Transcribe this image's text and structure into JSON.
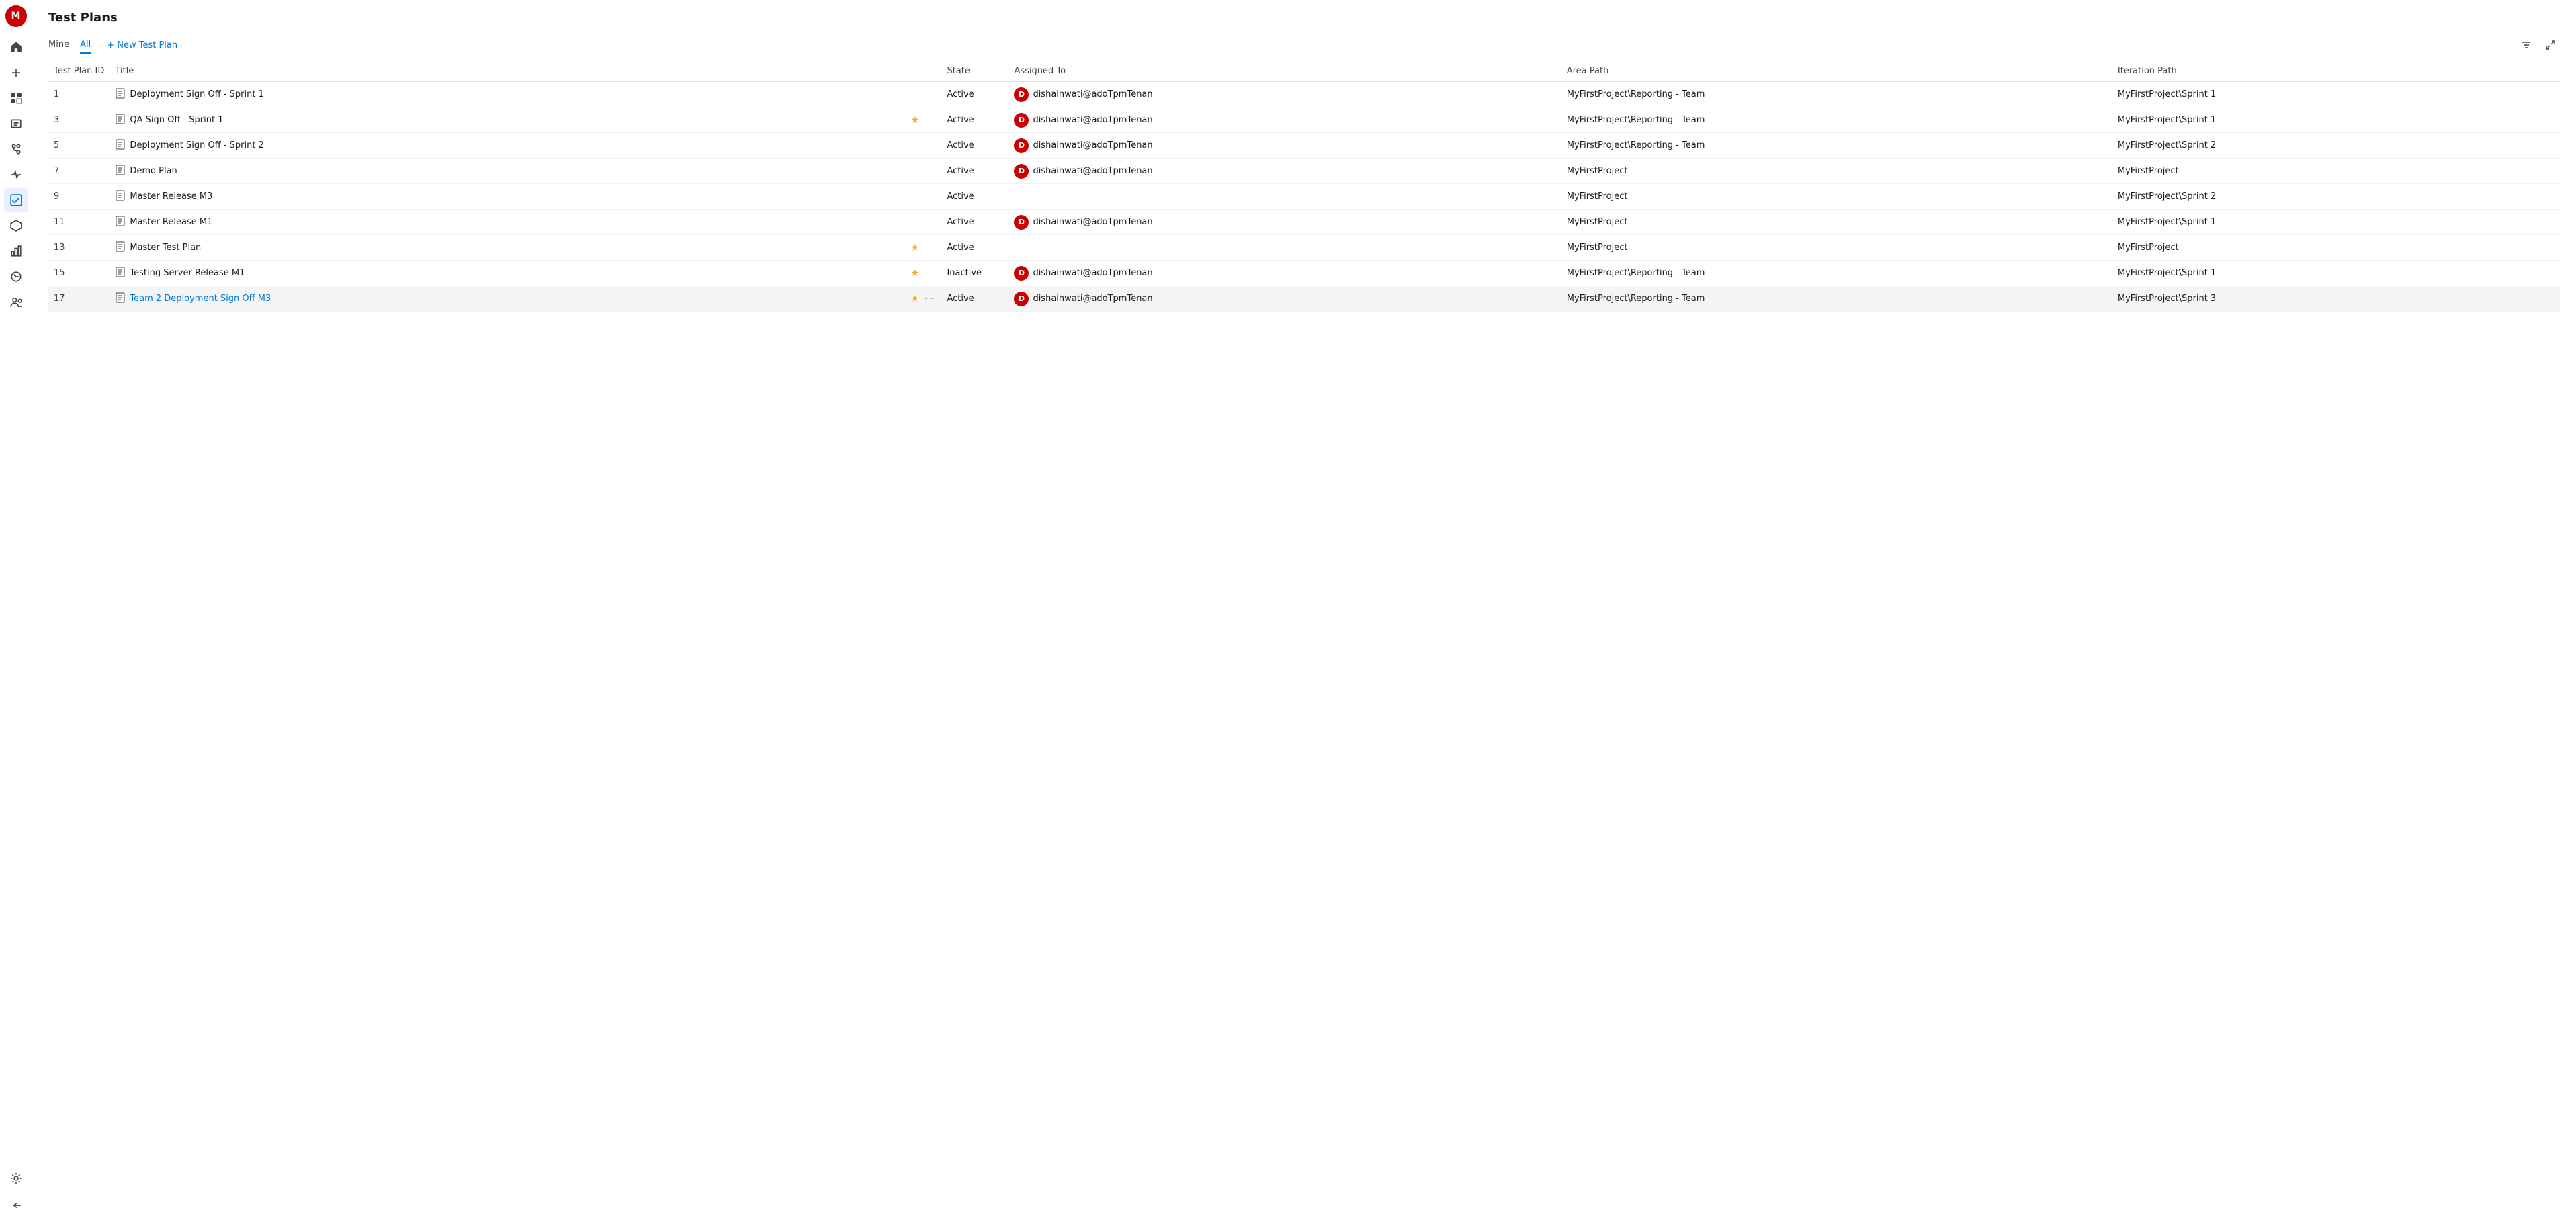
{
  "page": {
    "title": "Test Plans"
  },
  "nav": {
    "avatar_letter": "M",
    "icons": [
      {
        "name": "home-icon",
        "glyph": "⌂"
      },
      {
        "name": "plus-icon",
        "glyph": "+"
      },
      {
        "name": "board-icon",
        "glyph": "▦"
      },
      {
        "name": "work-icon",
        "glyph": "✎"
      },
      {
        "name": "repos-icon",
        "glyph": "⎇"
      },
      {
        "name": "pipelines-icon",
        "glyph": "▶"
      },
      {
        "name": "test-plans-icon",
        "glyph": "✅"
      },
      {
        "name": "artifacts-icon",
        "glyph": "📦"
      },
      {
        "name": "reports-icon",
        "glyph": "📊"
      },
      {
        "name": "analytics-icon",
        "glyph": "📈"
      },
      {
        "name": "stakeholder-icon",
        "glyph": "👥"
      },
      {
        "name": "wiki-icon",
        "glyph": "📖"
      }
    ],
    "bottom_icons": [
      {
        "name": "settings-icon",
        "glyph": "⚙"
      },
      {
        "name": "expand-icon",
        "glyph": "«"
      }
    ]
  },
  "tabs": [
    {
      "id": "mine",
      "label": "Mine",
      "active": false
    },
    {
      "id": "all",
      "label": "All",
      "active": true
    }
  ],
  "new_plan_btn": "+ New Test Plan",
  "filter_icon": "≡",
  "external_link_icon": "↗",
  "columns": [
    {
      "id": "id",
      "label": "Test Plan ID"
    },
    {
      "id": "title",
      "label": "Title"
    },
    {
      "id": "state",
      "label": "State"
    },
    {
      "id": "assigned",
      "label": "Assigned To"
    },
    {
      "id": "area",
      "label": "Area Path"
    },
    {
      "id": "iteration",
      "label": "Iteration Path"
    }
  ],
  "rows": [
    {
      "id": "1",
      "title": "Deployment Sign Off - Sprint 1",
      "is_link": false,
      "starred": false,
      "state": "Active",
      "assigned": "dishainwati@adoTpmTenan",
      "area": "MyFirstProject\\Reporting - Team",
      "iteration": "MyFirstProject\\Sprint 1"
    },
    {
      "id": "3",
      "title": "QA Sign Off - Sprint 1",
      "is_link": false,
      "starred": true,
      "state": "Active",
      "assigned": "dishainwati@adoTpmTenan",
      "area": "MyFirstProject\\Reporting - Team",
      "iteration": "MyFirstProject\\Sprint 1"
    },
    {
      "id": "5",
      "title": "Deployment Sign Off - Sprint 2",
      "is_link": false,
      "starred": false,
      "state": "Active",
      "assigned": "dishainwati@adoTpmTenan",
      "area": "MyFirstProject\\Reporting - Team",
      "iteration": "MyFirstProject\\Sprint 2"
    },
    {
      "id": "7",
      "title": "Demo Plan",
      "is_link": false,
      "starred": false,
      "state": "Active",
      "assigned": "dishainwati@adoTpmTenan",
      "area": "MyFirstProject",
      "iteration": "MyFirstProject"
    },
    {
      "id": "9",
      "title": "Master Release M3",
      "is_link": false,
      "starred": false,
      "state": "Active",
      "assigned": "",
      "area": "MyFirstProject",
      "iteration": "MyFirstProject\\Sprint 2"
    },
    {
      "id": "11",
      "title": "Master Release M1",
      "is_link": false,
      "starred": false,
      "state": "Active",
      "assigned": "dishainwati@adoTpmTenan",
      "area": "MyFirstProject",
      "iteration": "MyFirstProject\\Sprint 1"
    },
    {
      "id": "13",
      "title": "Master Test Plan",
      "is_link": false,
      "starred": true,
      "state": "Active",
      "assigned": "",
      "area": "MyFirstProject",
      "iteration": "MyFirstProject"
    },
    {
      "id": "15",
      "title": "Testing Server Release M1",
      "is_link": false,
      "starred": true,
      "state": "Inactive",
      "assigned": "dishainwati@adoTpmTenan",
      "area": "MyFirstProject\\Reporting - Team",
      "iteration": "MyFirstProject\\Sprint 1"
    },
    {
      "id": "17",
      "title": "Team 2 Deployment Sign Off M3",
      "is_link": true,
      "starred": true,
      "state": "Active",
      "assigned": "dishainwati@adoTpmTenan",
      "area": "MyFirstProject\\Reporting - Team",
      "iteration": "MyFirstProject\\Sprint 3"
    }
  ]
}
